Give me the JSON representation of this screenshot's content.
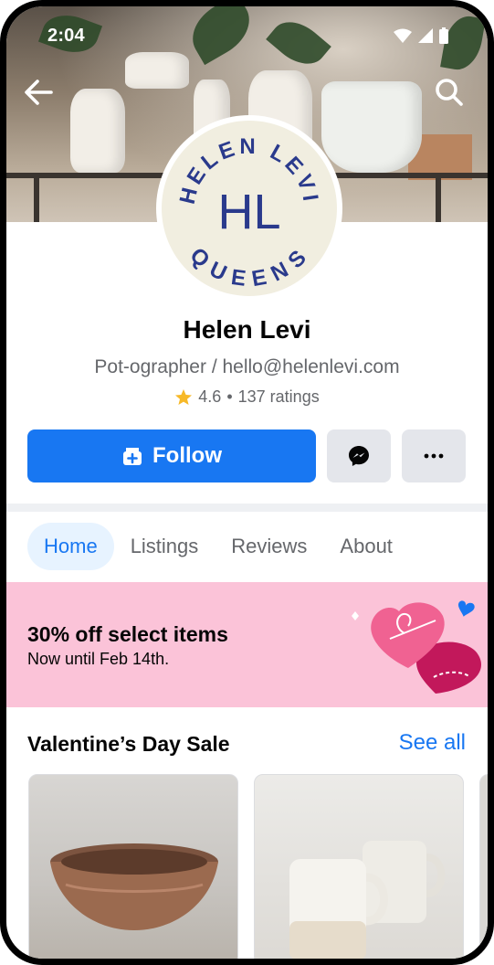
{
  "status_bar": {
    "time": "2:04"
  },
  "header": {
    "back_icon": "arrow-left-icon",
    "search_icon": "search-icon"
  },
  "profile": {
    "avatar_text_top": "HELEN LEVI",
    "avatar_monogram": "HL",
    "avatar_text_bottom": "QUEENS",
    "name": "Helen Levi",
    "bio": "Pot-ographer / hello@helenlevi.com",
    "rating_value": "4.6",
    "rating_separator": "•",
    "rating_count": "137 ratings"
  },
  "actions": {
    "follow_label": "Follow",
    "messenger_icon": "messenger-icon",
    "more_icon": "more-icon"
  },
  "tabs": [
    {
      "label": "Home",
      "active": true
    },
    {
      "label": "Listings",
      "active": false
    },
    {
      "label": "Reviews",
      "active": false
    },
    {
      "label": "About",
      "active": false
    }
  ],
  "promo": {
    "title": "30% off select items",
    "subtitle": "Now until Feb 14th."
  },
  "section": {
    "title": "Valentine’s Day Sale",
    "see_all": "See all"
  },
  "colors": {
    "accent": "#1877f2",
    "promo_bg": "#fbc3d8",
    "star": "#f7b928"
  }
}
